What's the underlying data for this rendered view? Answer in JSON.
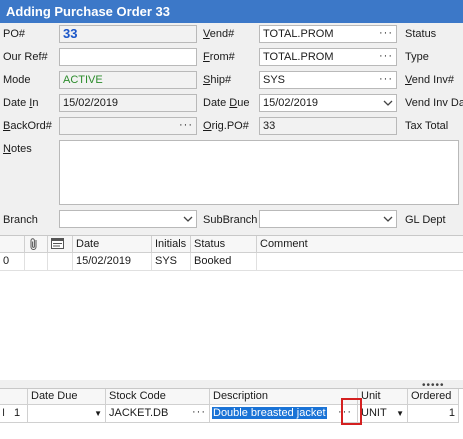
{
  "title": "Adding Purchase Order 33",
  "header": {
    "po_label": "PO#",
    "po_value": "33",
    "our_ref_label": "Our Ref#",
    "our_ref_value": "",
    "mode_label": "Mode",
    "mode_value": "ACTIVE",
    "date_in_label": "Date In",
    "date_in_value": "15/02/2019",
    "backord_label": "BackOrd#",
    "backord_value": "",
    "vend_label": "Vend#",
    "vend_value": "TOTAL.PROM",
    "from_label": "From#",
    "from_value": "TOTAL.PROM",
    "ship_label": "Ship#",
    "ship_value": "SYS",
    "date_due_label": "Date Due",
    "date_due_value": "15/02/2019",
    "orig_po_label": "Orig.PO#",
    "orig_po_value": "33",
    "status_label": "Status",
    "type_label": "Type",
    "vend_inv_label": "Vend Inv#",
    "vend_inv_date_label": "Vend Inv Da",
    "tax_total_label": "Tax Total",
    "notes_label": "Notes",
    "branch_label": "Branch",
    "branch_value": "",
    "subbranch_label": "SubBranch",
    "subbranch_value": "",
    "gl_dept_label": "GL Dept",
    "ellipsis": "···"
  },
  "history_grid": {
    "columns": [
      "",
      "",
      "",
      "Date",
      "Initials",
      "Status",
      "Comment"
    ],
    "rows": [
      {
        "index": "0",
        "date": "15/02/2019",
        "initials": "SYS",
        "status": "Booked",
        "comment": ""
      }
    ]
  },
  "lines_grid": {
    "columns": [
      "",
      "Date Due",
      "Stock Code",
      "Description",
      "Unit",
      "Ordered"
    ],
    "rows": [
      {
        "marker": "I",
        "num": "1",
        "date_due": "",
        "stock_code": "JACKET.DB",
        "description": "Double breasted jacket",
        "unit": "UNIT",
        "ordered": "1"
      }
    ]
  },
  "colors": {
    "title_bar": "#3c78c8",
    "po_number": "#1a55c8",
    "active": "#2c8c2c",
    "selection": "#1a73d6",
    "highlight_box": "#d42020"
  },
  "icons": [
    "attachment-icon",
    "note-icon",
    "chevron-down-icon",
    "ellipsis-icon",
    "grip-icon",
    "row-cursor-icon"
  ]
}
